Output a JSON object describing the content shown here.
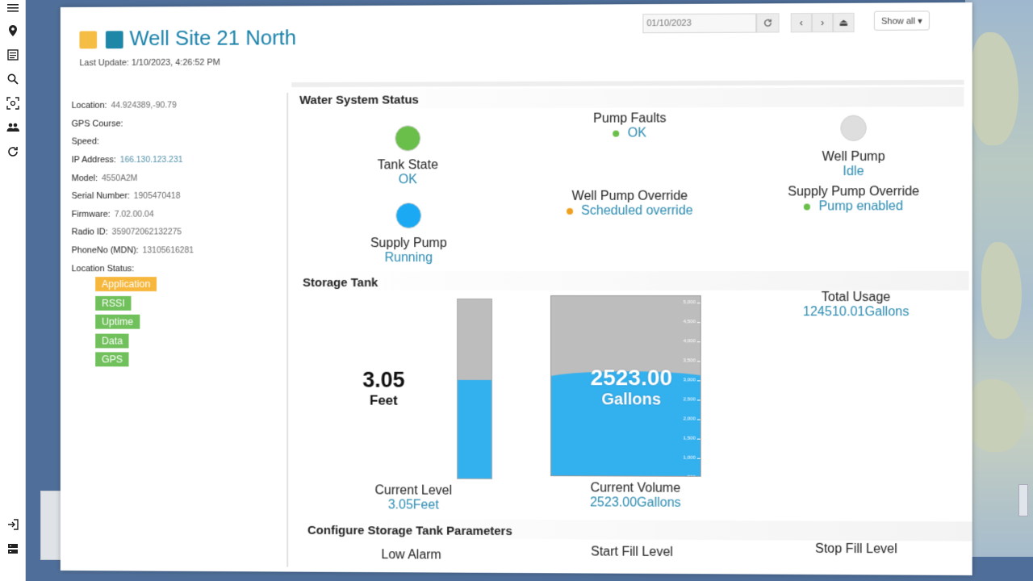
{
  "header": {
    "title": "Well Site 21 North",
    "last_update": "Last Update: 1/10/2023, 4:26:52 PM",
    "date_value": "01/10/2023",
    "show_all_label": "Show all ▾",
    "square_colors": [
      "#f6bd44",
      "#1e87a8"
    ]
  },
  "rail": {
    "icons": [
      "menu-icon",
      "location-pin-icon",
      "list-icon",
      "search-icon",
      "scan-icon",
      "people-icon",
      "refresh-icon",
      "logout-icon",
      "storage-icon"
    ]
  },
  "info": {
    "rows": [
      {
        "label": "Location:",
        "value": "44.924389,-90.79"
      },
      {
        "label": "GPS Course:",
        "value": ""
      },
      {
        "label": "Speed:",
        "value": ""
      },
      {
        "label": "IP Address:",
        "value": "166.130.123.231"
      },
      {
        "label": "Model:",
        "value": "4550A2M"
      },
      {
        "label": "Serial Number:",
        "value": "1905470418"
      },
      {
        "label": "Firmware:",
        "value": "7.02.00.04"
      },
      {
        "label": "Radio ID:",
        "value": "359072062132275"
      },
      {
        "label": "PhoneNo (MDN):",
        "value": "13105616281"
      },
      {
        "label": "Location Status:",
        "value": ""
      }
    ],
    "status_tags": [
      {
        "label": "Application",
        "color": "orange"
      },
      {
        "label": "RSSI",
        "color": "green"
      },
      {
        "label": "Uptime",
        "color": "green"
      },
      {
        "label": "Data",
        "color": "green"
      },
      {
        "label": "GPS",
        "color": "green"
      }
    ]
  },
  "water_status": {
    "heading": "Water System Status",
    "tank_state": {
      "label": "Tank State",
      "value": "OK",
      "color": "#6abf4b"
    },
    "supply_pump": {
      "label": "Supply Pump",
      "value": "Running",
      "color": "#1aa9f2"
    },
    "pump_faults": {
      "label": "Pump Faults",
      "value": "OK",
      "color": "#6abf4b"
    },
    "well_pump_override": {
      "label": "Well Pump Override",
      "value": "Scheduled override",
      "color": "#f0a020"
    },
    "well_pump": {
      "label": "Well Pump",
      "value": "Idle",
      "color": "#dddddd"
    },
    "supply_pump_override": {
      "label": "Supply Pump Override",
      "value": "Pump enabled",
      "color": "#6abf4b"
    }
  },
  "storage": {
    "heading": "Storage Tank",
    "level_number": "3.05",
    "level_unit": "Feet",
    "level_fill_fraction": 0.55,
    "current_level_label": "Current Level",
    "current_level_value": "3.05Feet",
    "volume_number": "2523.00",
    "volume_unit": "Gallons",
    "volume_fill_fraction": 0.54,
    "current_volume_label": "Current Volume",
    "current_volume_value": "2523.00Gallons",
    "total_usage_label": "Total Usage",
    "total_usage_value": "124510.01Gallons",
    "scale_labels": [
      "5,000",
      "4,500",
      "4,000",
      "3,500",
      "3,000",
      "2,500",
      "2,000",
      "1,500",
      "1,000",
      "500"
    ]
  },
  "configure": {
    "heading": "Configure Storage Tank Parameters",
    "low_alarm": "Low Alarm",
    "start_fill": "Start Fill Level",
    "stop_fill": "Stop Fill Level"
  }
}
